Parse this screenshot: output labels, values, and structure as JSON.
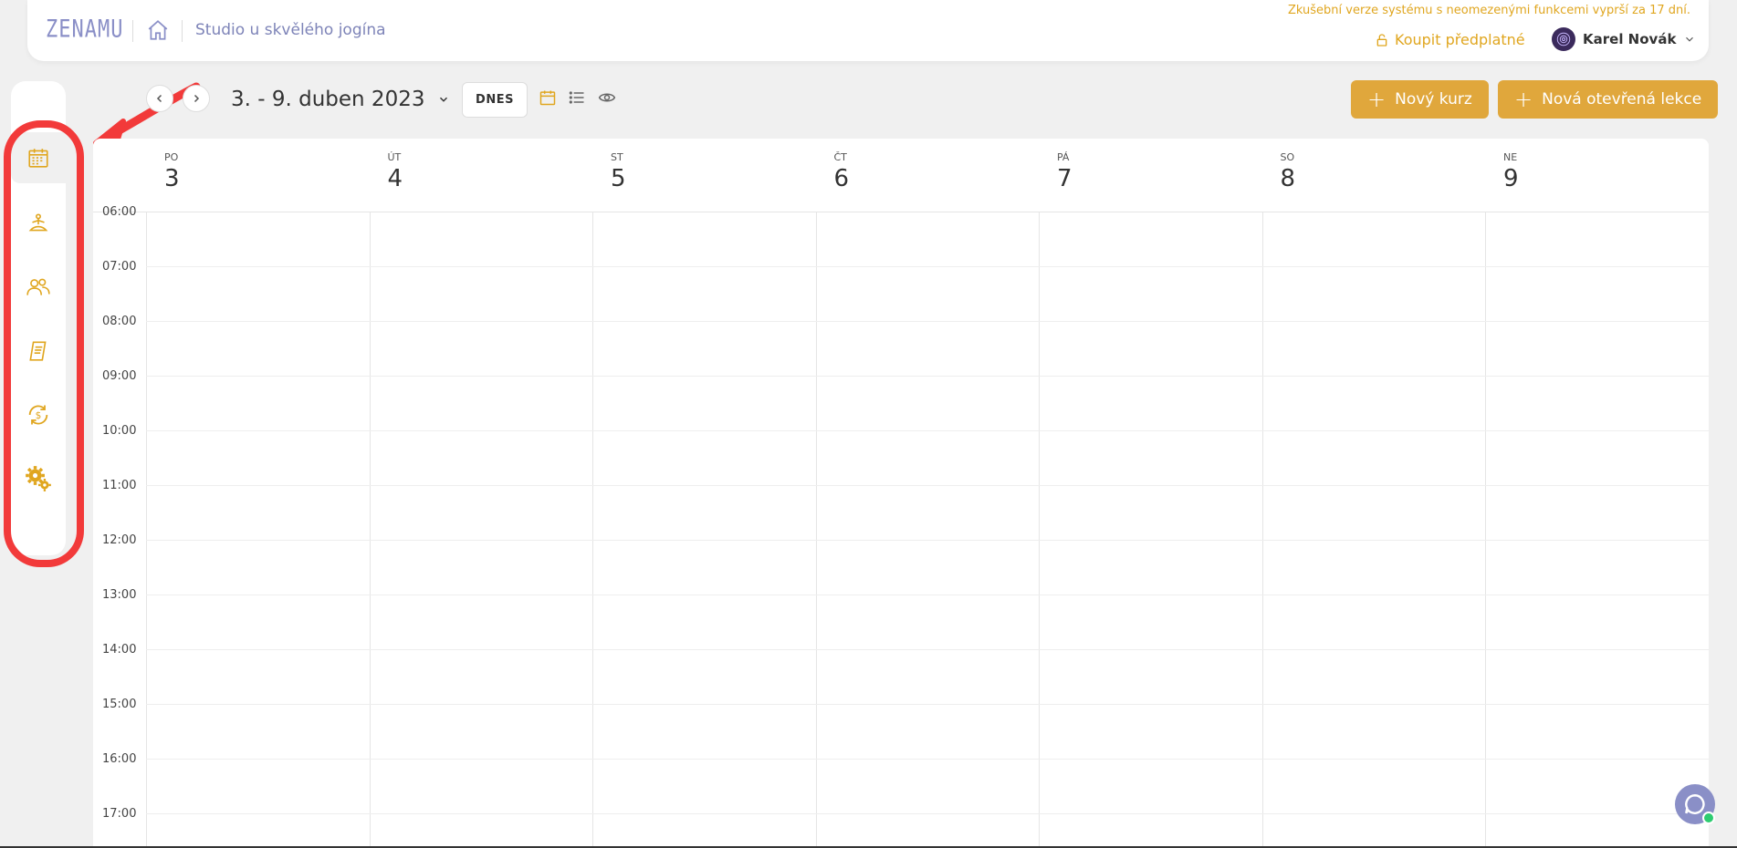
{
  "header": {
    "logo": "ZENAMU",
    "studio_name": "Studio u skvělého jogína",
    "trial_notice": "Zkušební verze systému s neomezenými funkcemi vyprší za 17 dní.",
    "buy_label": "Koupit předplatné",
    "user_name": "Karel Novák"
  },
  "toolbar": {
    "date_range": "3. - 9. duben 2023",
    "today_label": "DNES",
    "new_course_label": "Nový kurz",
    "new_open_lesson_label": "Nová otevřená lekce"
  },
  "sidebar": {
    "items": [
      {
        "icon": "calendar-icon",
        "active": true
      },
      {
        "icon": "yoga-icon",
        "active": false
      },
      {
        "icon": "users-icon",
        "active": false
      },
      {
        "icon": "receipt-icon",
        "active": false
      },
      {
        "icon": "payment-icon",
        "active": false
      },
      {
        "icon": "settings-icon",
        "active": false
      }
    ]
  },
  "calendar": {
    "days": [
      {
        "abbr": "PO",
        "num": "3"
      },
      {
        "abbr": "ÚT",
        "num": "4"
      },
      {
        "abbr": "ST",
        "num": "5"
      },
      {
        "abbr": "ČT",
        "num": "6"
      },
      {
        "abbr": "PÁ",
        "num": "7"
      },
      {
        "abbr": "SO",
        "num": "8"
      },
      {
        "abbr": "NE",
        "num": "9"
      }
    ],
    "hours": [
      "06:00",
      "07:00",
      "08:00",
      "09:00",
      "10:00",
      "11:00",
      "12:00",
      "13:00",
      "14:00",
      "15:00",
      "16:00",
      "17:00"
    ]
  },
  "colors": {
    "accent": "#e0a73c",
    "brand": "#8a8fc7",
    "annotation": "#f23a3a"
  }
}
